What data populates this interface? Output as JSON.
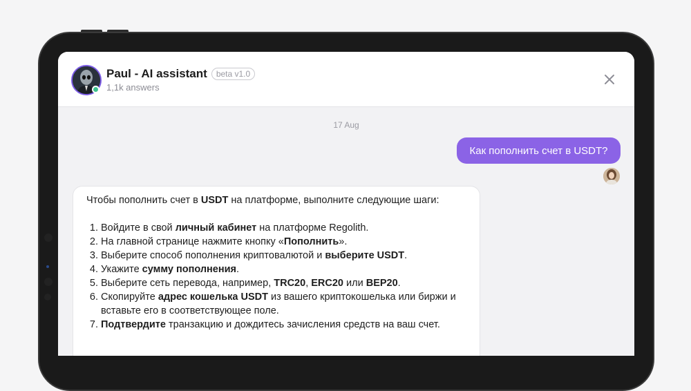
{
  "chat": {
    "assistant_name": "Paul - AI assistant",
    "badge": "beta v1.0",
    "answers_count": "1,1k answers",
    "date": "17 Aug"
  },
  "user_message": "Как пополнить счет в USDT?",
  "bot_message": {
    "intro": [
      "Чтобы пополнить счет в ",
      "USDT",
      " на платформе, выполните следующие шаги:"
    ],
    "steps": [
      [
        "Войдите в свой ",
        "личный кабинет",
        " на платформе Regolith."
      ],
      [
        "На главной странице нажмите кнопку «",
        "Пополнить",
        "»."
      ],
      [
        "Выберите способ пополнения криптовалютой и ",
        "выберите USDT",
        "."
      ],
      [
        "Укажите ",
        "сумму пополнения",
        "."
      ],
      [
        "Выберите сеть перевода, например, ",
        "TRC20",
        ", ",
        "ERC20",
        " или ",
        "BEP20",
        "."
      ],
      [
        "Скопируйте ",
        "адрес кошелька USDT",
        " из вашего криптокошелька или биржи и вставьте его в соответствующее поле."
      ],
      [
        "",
        "Подтвердите",
        " транзакцию и дождитесь зачисления средств на ваш счет."
      ]
    ]
  },
  "icons": {
    "close": "close-icon",
    "online": "online-status-icon"
  },
  "colors": {
    "accent": "#8b63e6",
    "online": "#3ec28f",
    "background": "#f2f2f4"
  }
}
